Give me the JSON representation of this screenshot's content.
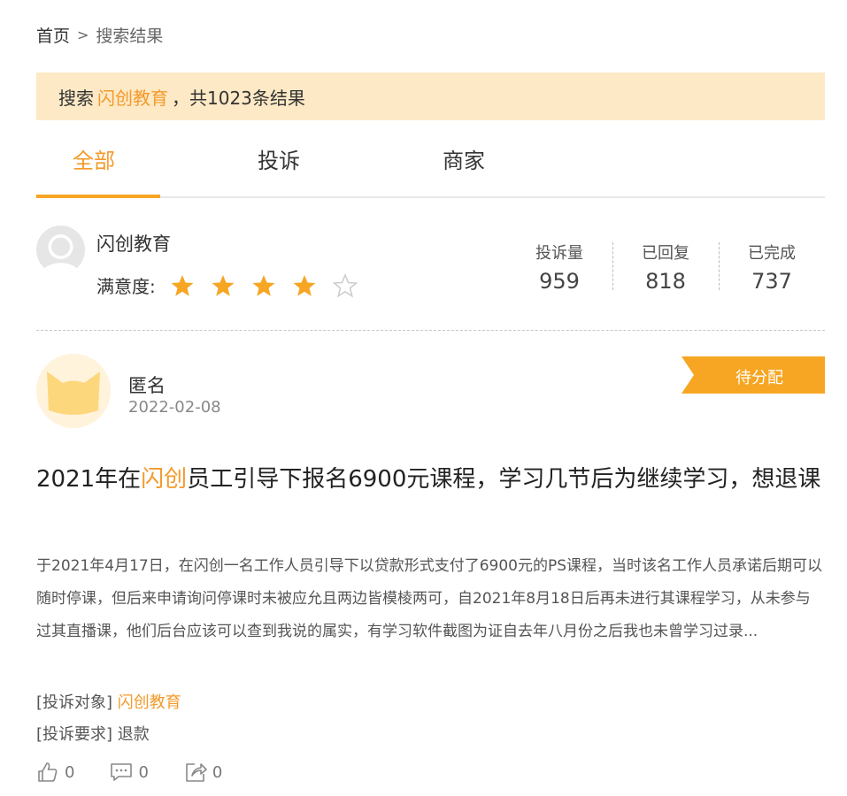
{
  "breadcrumb": {
    "home": "首页",
    "separator": ">",
    "current": "搜索结果"
  },
  "search": {
    "prefix": "搜索",
    "keyword": "闪创教育",
    "suffix": "，共1023条结果"
  },
  "tabs": [
    {
      "label": "全部",
      "active": true
    },
    {
      "label": "投诉"
    },
    {
      "label": "商家"
    }
  ],
  "merchant": {
    "name": "闪创教育",
    "satisfaction_label": "满意度:",
    "rating": 4,
    "rating_max": 5,
    "stats": [
      {
        "label": "投诉量",
        "value": "959"
      },
      {
        "label": "已回复",
        "value": "818"
      },
      {
        "label": "已完成",
        "value": "737"
      }
    ]
  },
  "post": {
    "author": "匿名",
    "date": "2022-02-08",
    "status": "待分配",
    "title_pre": "2021年在",
    "title_highlight": "闪创",
    "title_post": "员工引导下报名6900元课程，学习几节后为继续学习，想退课",
    "body": "于2021年4月17日，在闪创一名工作人员引导下以贷款形式支付了6900元的PS课程，当时该名工作人员承诺后期可以随时停课，但后来申请询问停课时未被应允且两边皆模棱两可，自2021年8月18日后再未进行其课程学习，从未参与过其直播课，他们后台应该可以查到我说的属实，有学习软件截图为证自去年八月份之后我也未曾学习过录...",
    "target_label": "[投诉对象]",
    "target_value": "闪创教育",
    "demand_label": "[投诉要求]",
    "demand_value": "退款",
    "likes": "0",
    "comments": "0",
    "shares": "0"
  },
  "colors": {
    "accent": "#f39a2b",
    "banner_bg": "#fde9c5",
    "status_tag": "#f6a623",
    "star_filled": "#f6a623",
    "star_empty": "#cccccc"
  }
}
